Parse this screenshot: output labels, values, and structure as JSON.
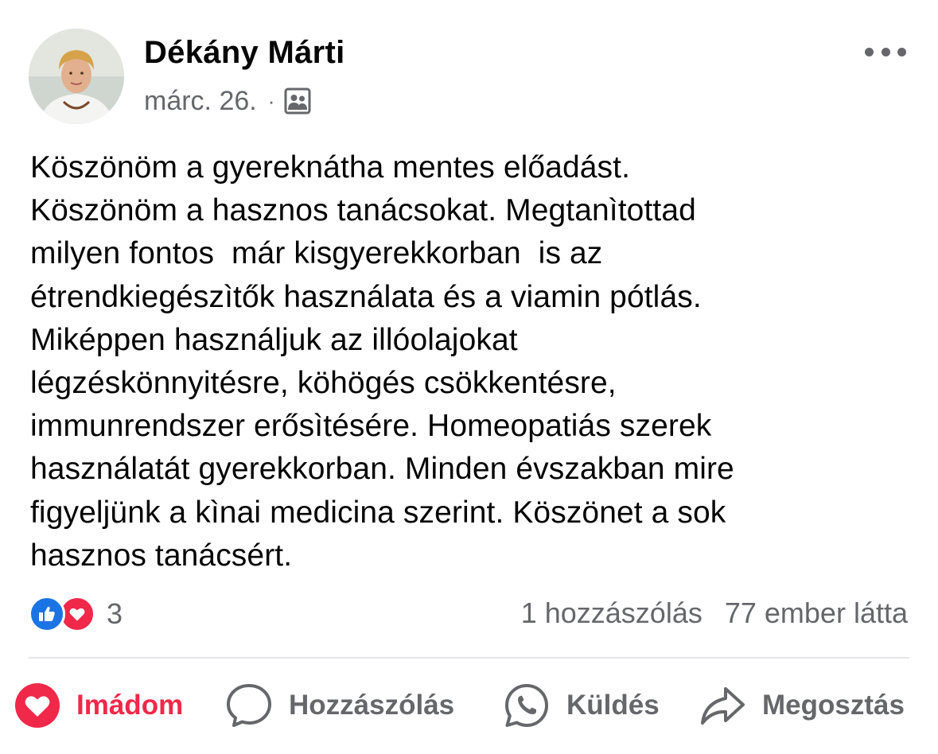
{
  "post": {
    "author": "Dékány Márti",
    "date": "márc. 26.",
    "separator": "·",
    "audience_icon": "group-audience-icon",
    "more_icon": "more-options-icon",
    "text_lines": [
      "Köszönöm a gyereknátha mentes előadást.",
      "Köszönöm a hasznos tanácsokat. Megtanìtottad",
      "milyen fontos  már kisgyerekkorban  is az",
      "étrendkiegészìtők használata és a viamin pótlás.",
      "Miképpen használjuk az illóolajokat",
      "légzéskönnyitésre, köhögés csökkentésre,",
      "immunrendszer erősìtésére. Homeopatiás szerek",
      "használatát gyerekkorban. Minden évszakban mire",
      "figyeljünk a kìnai medicina szerint. Köszönet a sok",
      "hasznos tanácsért."
    ]
  },
  "reactions": {
    "icons": [
      "like-reaction-icon",
      "love-reaction-icon"
    ],
    "count": "3",
    "comments": "1 hozzászólás",
    "views": "77 ember látta"
  },
  "actions": {
    "love": "Imádom",
    "comment": "Hozzászólás",
    "send": "Küldés",
    "share": "Megosztás"
  },
  "colors": {
    "accent_love": "#f0284a",
    "like_blue": "#1b74e4",
    "secondary_text": "#65676b",
    "divider": "#e4e6eb"
  }
}
